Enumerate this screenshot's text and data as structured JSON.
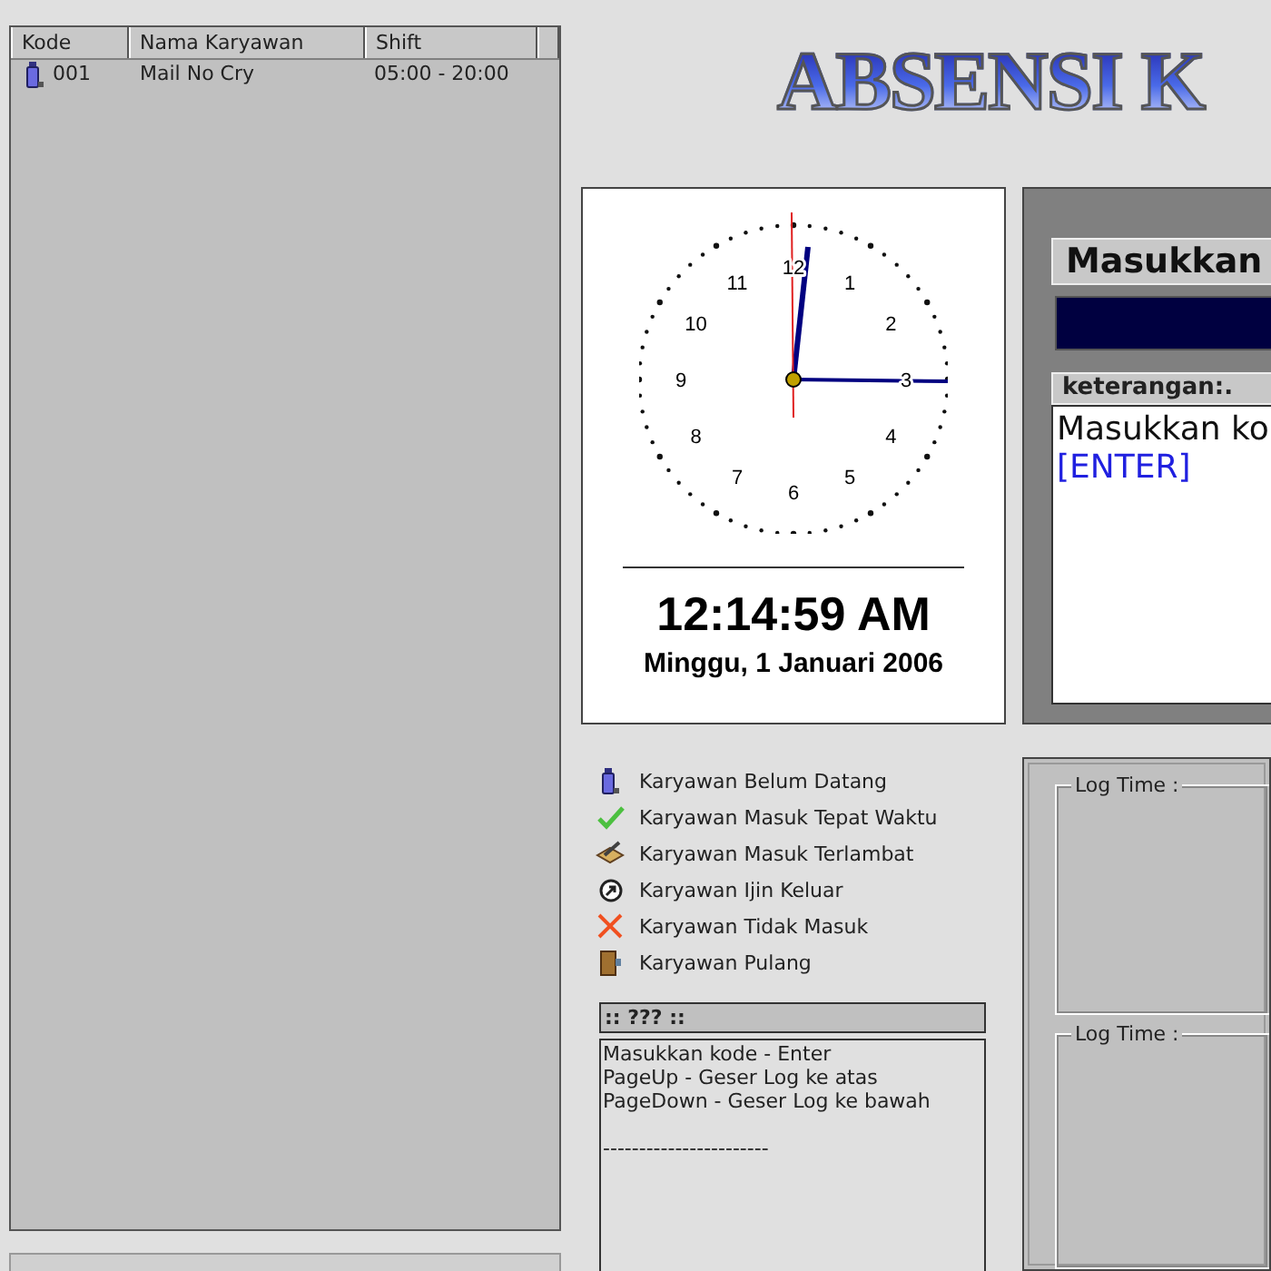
{
  "employee_table": {
    "columns": [
      "Kode",
      "Nama Karyawan",
      "Shift"
    ],
    "rows": [
      {
        "kind": "belum_datang",
        "kode": "001",
        "nama": "Mail No Cry",
        "shift": "05:00 - 20:00"
      }
    ]
  },
  "title": "ABSENSI K",
  "clock": {
    "numerals": [
      "12",
      "1",
      "2",
      "3",
      "4",
      "5",
      "6",
      "7",
      "8",
      "9",
      "10",
      "11"
    ],
    "time": "12:14:59 AM",
    "date": "Minggu, 1 Januari 2006"
  },
  "entry": {
    "label": "Masukkan",
    "info_label": "keterangan:.",
    "info_text": "Masukkan ko",
    "info_key": "[ENTER]"
  },
  "legend": [
    {
      "kind": "belum_datang",
      "label": "Karyawan Belum Datang"
    },
    {
      "kind": "tepat_waktu",
      "label": "Karyawan Masuk Tepat Waktu"
    },
    {
      "kind": "terlambat",
      "label": "Karyawan Masuk Terlambat"
    },
    {
      "kind": "ijin_keluar",
      "label": "Karyawan Ijin Keluar"
    },
    {
      "kind": "tidak_masuk",
      "label": "Karyawan Tidak Masuk"
    },
    {
      "kind": "pulang",
      "label": "Karyawan Pulang"
    }
  ],
  "help": {
    "title": ":: ??? ::",
    "lines": [
      "Masukkan kode - Enter",
      "PageUp - Geser Log ke atas",
      "PageDown - Geser Log ke bawah"
    ],
    "divider": "-----------------------"
  },
  "log_panels": [
    {
      "label": "Log Time :"
    },
    {
      "label": "Log Time :"
    }
  ]
}
